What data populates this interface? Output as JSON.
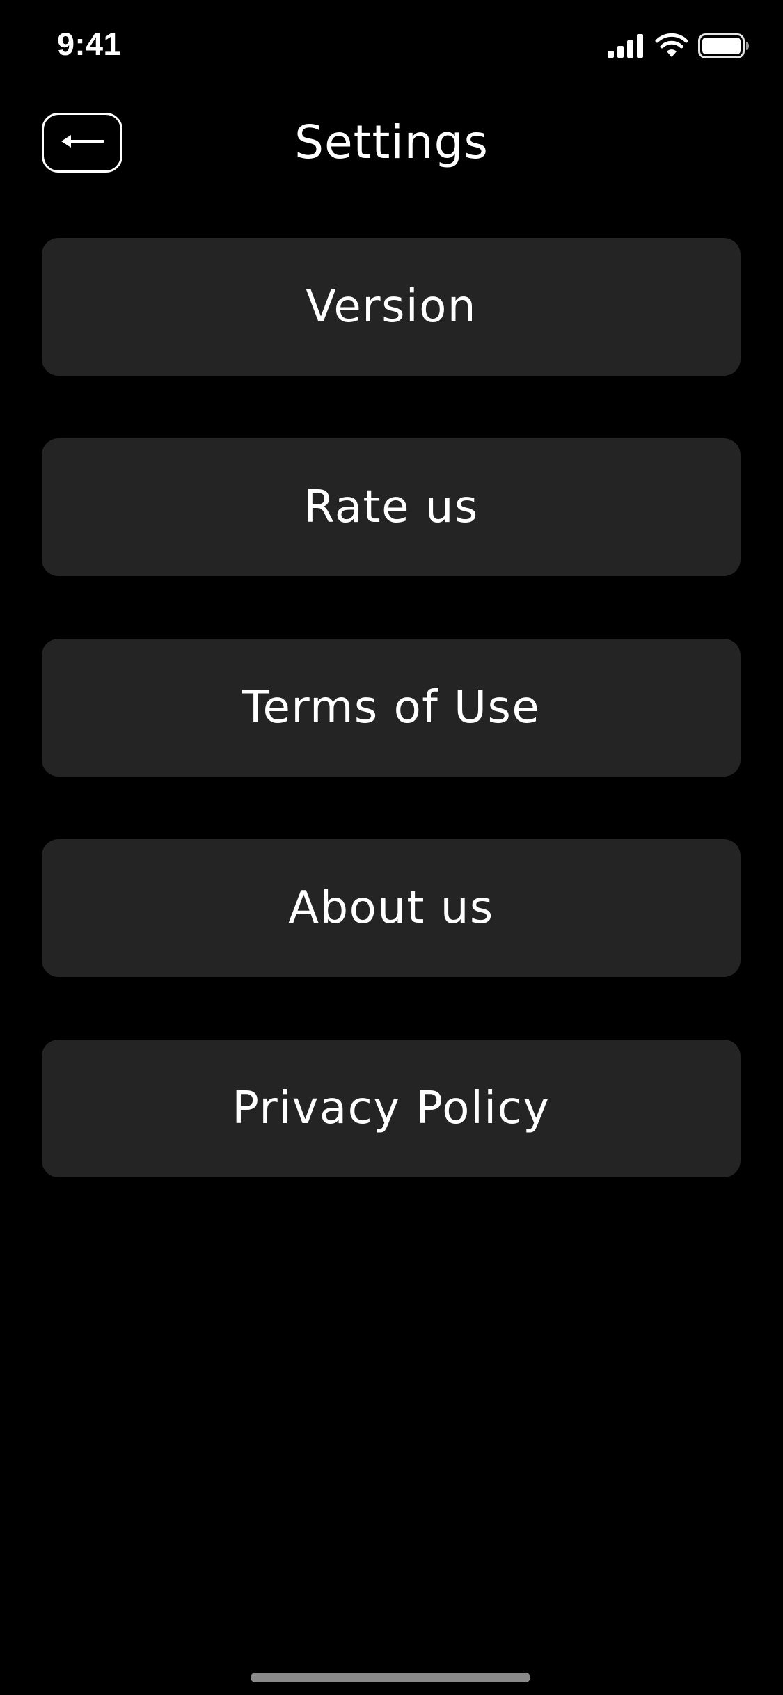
{
  "status_bar": {
    "time": "9:41",
    "icons": [
      "cellular-signal-icon",
      "wifi-icon",
      "battery-icon"
    ]
  },
  "header": {
    "title": "Settings",
    "back_icon": "arrow-left-icon"
  },
  "menu": {
    "items": [
      {
        "label": "Version"
      },
      {
        "label": "Rate us"
      },
      {
        "label": "Terms of Use"
      },
      {
        "label": "About us"
      },
      {
        "label": "Privacy Policy"
      }
    ]
  },
  "colors": {
    "background": "#000000",
    "card": "#242424",
    "text": "#ffffff",
    "home_indicator": "#8a8a8a"
  }
}
